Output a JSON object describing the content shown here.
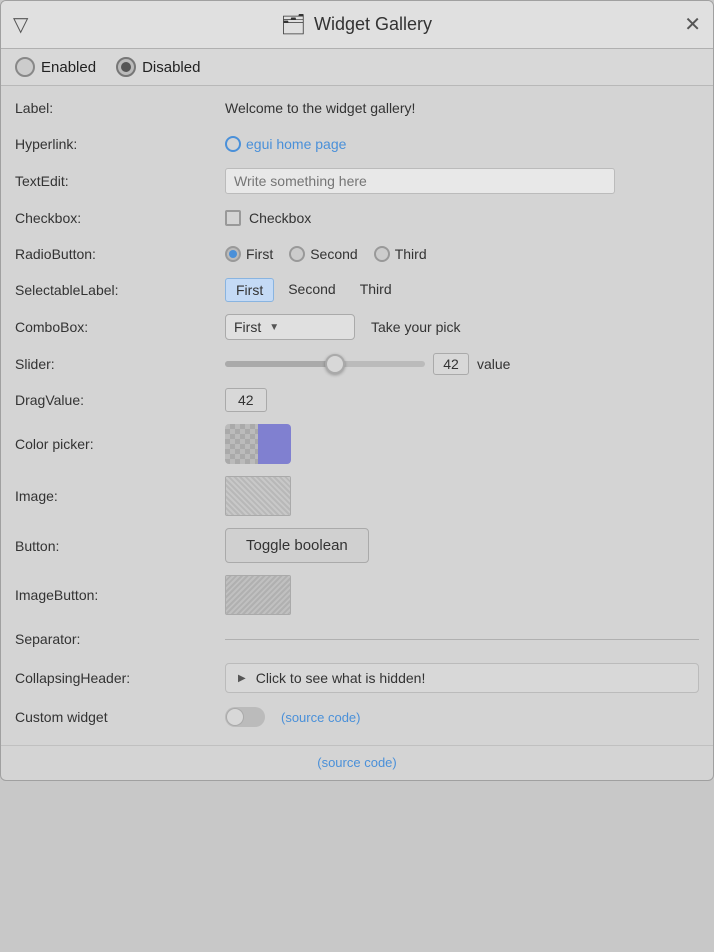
{
  "window": {
    "title": "Widget Gallery",
    "icon": "🗂",
    "menu_icon": "▽",
    "close": "✕"
  },
  "toolbar": {
    "enabled_label": "Enabled",
    "disabled_label": "Disabled"
  },
  "rows": {
    "label": {
      "key": "Label:",
      "value": "Welcome to the widget gallery!"
    },
    "hyperlink": {
      "key": "Hyperlink:",
      "text": "egui home page"
    },
    "textedit": {
      "key": "TextEdit:",
      "placeholder": "Write something here"
    },
    "checkbox": {
      "key": "Checkbox:",
      "label": "Checkbox"
    },
    "radiobutton": {
      "key": "RadioButton:",
      "options": [
        "First",
        "Second",
        "Third"
      ],
      "selected": 0
    },
    "selectable_label": {
      "key": "SelectableLabel:",
      "options": [
        "First",
        "Second",
        "Third"
      ],
      "selected": 0
    },
    "combobox": {
      "key": "ComboBox:",
      "selected": "First",
      "hint": "Take your pick"
    },
    "slider": {
      "key": "Slider:",
      "value": 42,
      "unit": "value",
      "percent": 55
    },
    "drag_value": {
      "key": "DragValue:",
      "value": "42"
    },
    "color_picker": {
      "key": "Color picker:"
    },
    "image": {
      "key": "Image:"
    },
    "button": {
      "key": "Button:",
      "label": "Toggle boolean"
    },
    "image_button": {
      "key": "ImageButton:"
    },
    "separator": {
      "key": "Separator:"
    },
    "collapsing_header": {
      "key": "CollapsingHeader:",
      "label": "Click to see what is hidden!"
    },
    "custom_widget": {
      "key": "Custom widget",
      "source_code": "(source code)"
    }
  },
  "footer": {
    "source_code": "(source code)"
  }
}
